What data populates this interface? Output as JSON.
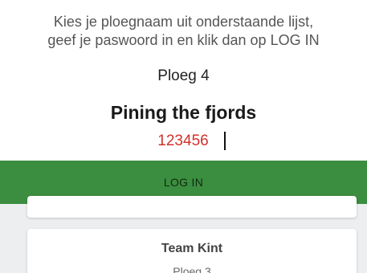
{
  "instructions": {
    "line1": "Kies je ploegnaam uit onderstaande lijst,",
    "line2": "geef je paswoord in en klik dan op LOG IN"
  },
  "selected_team": {
    "number": "Ploeg 4",
    "name": "Pining the fjords"
  },
  "password": {
    "value": "123456"
  },
  "login_button": {
    "label": "LOG IN"
  },
  "team_list": [
    {
      "name": "Team Kint",
      "number": "Ploeg 3"
    }
  ],
  "colors": {
    "login_button_bg": "#3b8e3f",
    "password_text": "#d0322c",
    "list_background": "#eceef0"
  }
}
